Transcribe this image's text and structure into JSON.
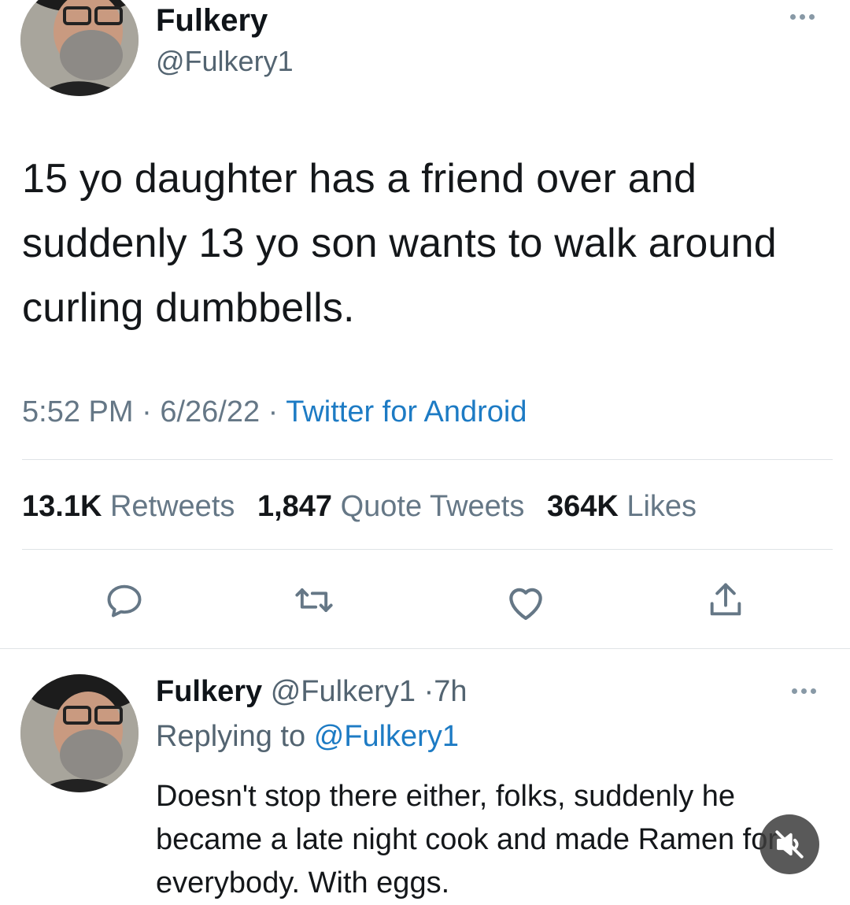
{
  "tweet": {
    "author_name": "Fulkery",
    "author_handle": "@Fulkery1",
    "text": "15 yo daughter has a friend over and suddenly 13 yo son wants to walk around curling dumbbells.",
    "time": "5:52 PM",
    "date": "6/26/22",
    "separator": "·",
    "source": "Twitter for Android",
    "stats": {
      "retweets_count": "13.1K",
      "retweets_label": "Retweets",
      "quotes_count": "1,847",
      "quotes_label": "Quote Tweets",
      "likes_count": "364K",
      "likes_label": "Likes"
    },
    "actions": [
      "reply-icon",
      "retweet-icon",
      "like-icon",
      "share-icon"
    ],
    "more_icon": "more-horizontal-icon"
  },
  "reply": {
    "author_name": "Fulkery",
    "author_handle": "@Fulkery1",
    "separator": "·",
    "age": "7h",
    "replying_prefix": "Replying to",
    "replying_mention": "@Fulkery1",
    "text": "Doesn't stop there either, folks, suddenly he became a late night cook and made Ramen for everybody. With eggs."
  },
  "overlay": {
    "mute_icon": "speaker-muted-icon"
  },
  "colors": {
    "text": "#14171a",
    "secondary": "#657786",
    "link": "#1d7bc4",
    "divider": "#dfe3e6"
  }
}
